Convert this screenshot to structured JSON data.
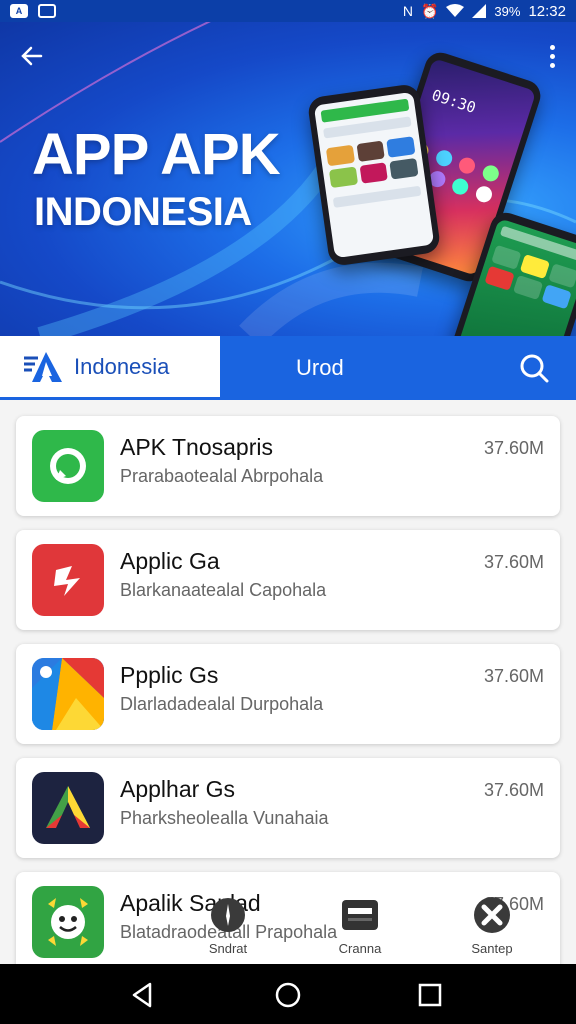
{
  "status_bar": {
    "battery": "39%",
    "time": "12:32",
    "left_icons": [
      "app-notification-icon",
      "message-icon"
    ],
    "right_icons": [
      "nfc-icon",
      "alarm-icon",
      "wifi-icon",
      "signal-icon"
    ]
  },
  "hero": {
    "title": "APP APK",
    "subtitle": "INDONESIA",
    "phone_clock": "09:30"
  },
  "tabs": {
    "active_label": "Indonesia",
    "second_label": "Urod"
  },
  "apps": [
    {
      "name": "APK Tnosapris",
      "description": "Prarabaotealal Abrpohala",
      "size": "37.60M",
      "icon": "whatsapp-style-icon",
      "color": "#2fb84a"
    },
    {
      "name": "Applic Ga",
      "description": "Blarkanaatealal Capohala",
      "size": "37.60M",
      "icon": "red-app-icon",
      "color": "#e0373a"
    },
    {
      "name": "Ppplic Gs",
      "description": "Dlarladadealal Durpohala",
      "size": "37.60M",
      "icon": "colorful-tile-icon",
      "color": "#2b7be0"
    },
    {
      "name": "Applhar Gs",
      "description": "Pharksheolealla Vunahaia",
      "size": "37.60M",
      "icon": "play-triangle-icon",
      "color": "#1d2340"
    },
    {
      "name": "Apalik Sanlad",
      "description": "Blatadraodeatall Prapohala",
      "size": "37.60M",
      "icon": "smiley-icon",
      "color": "#31a443"
    }
  ],
  "bottom_nav": [
    {
      "label": "Sndrat",
      "icon": "info-icon"
    },
    {
      "label": "Cranna",
      "icon": "card-icon"
    },
    {
      "label": "Santep",
      "icon": "tools-icon"
    }
  ]
}
